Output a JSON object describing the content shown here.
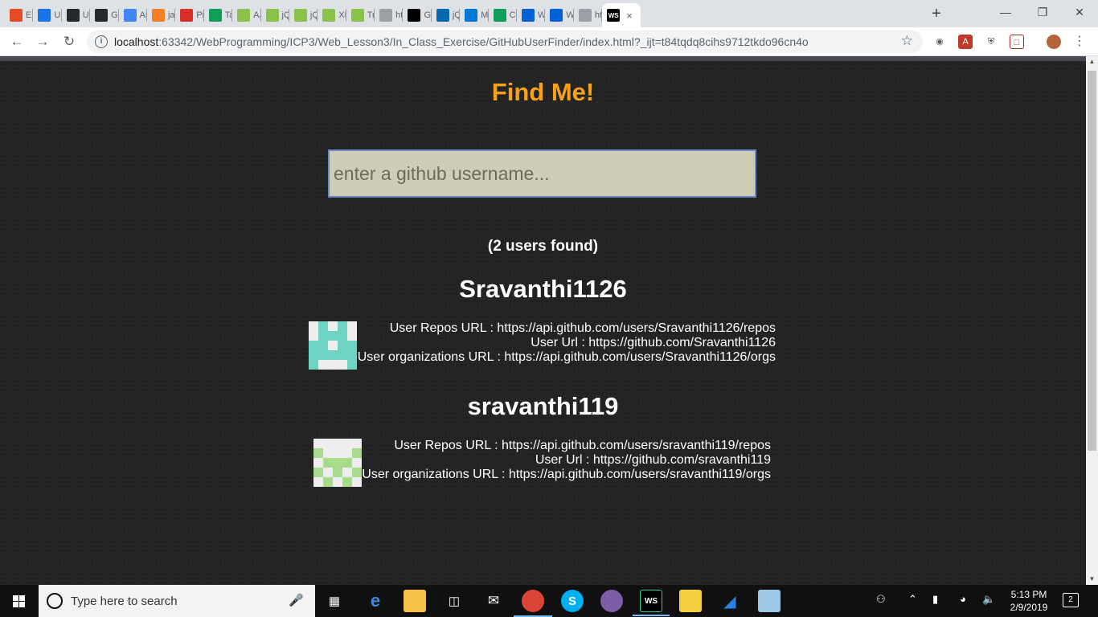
{
  "browser": {
    "tabs": [
      {
        "label": "Ex",
        "icon": "grid-icon",
        "color": "#e34c26"
      },
      {
        "label": "Us",
        "icon": "logo-icon",
        "color": "#1a73e8"
      },
      {
        "label": "Us",
        "icon": "github-icon",
        "color": "#24292e"
      },
      {
        "label": "Gi",
        "icon": "github-icon",
        "color": "#24292e"
      },
      {
        "label": "As",
        "icon": "google-icon",
        "color": "#4285f4"
      },
      {
        "label": "ja",
        "icon": "stackoverflow-icon",
        "color": "#f48024"
      },
      {
        "label": "Pi",
        "icon": "gmail-icon",
        "color": "#d93025"
      },
      {
        "label": "Ta",
        "icon": "drive-icon",
        "color": "#0f9d58"
      },
      {
        "label": "AJ",
        "icon": "w3schools-icon",
        "color": "#8bc34a"
      },
      {
        "label": "jQ",
        "icon": "w3schools-icon",
        "color": "#8bc34a"
      },
      {
        "label": "jQ",
        "icon": "w3schools-icon",
        "color": "#8bc34a"
      },
      {
        "label": "XM",
        "icon": "w3schools-icon",
        "color": "#8bc34a"
      },
      {
        "label": "Tr",
        "icon": "w3schools-icon",
        "color": "#8bc34a"
      },
      {
        "label": "ht",
        "icon": "page-icon",
        "color": "#9aa0a6"
      },
      {
        "label": "Gi",
        "icon": "webstorm-icon",
        "color": "#000000"
      },
      {
        "label": "jQ",
        "icon": "jquery-icon",
        "color": "#0769ad"
      },
      {
        "label": "M",
        "icon": "outlook-icon",
        "color": "#0078d4"
      },
      {
        "label": "CS",
        "icon": "sheets-icon",
        "color": "#0f9d58"
      },
      {
        "label": "W",
        "icon": "box-icon",
        "color": "#0061d5"
      },
      {
        "label": "W",
        "icon": "box-icon",
        "color": "#0061d5"
      },
      {
        "label": "ht",
        "icon": "page-icon",
        "color": "#9aa0a6"
      }
    ],
    "active_tab": {
      "icon": "webstorm-icon",
      "close": "×"
    },
    "new_tab": "+",
    "url_host": "localhost",
    "url_rest": ":63342/WebProgramming/ICP3/Web_Lesson3/In_Class_Exercise/GitHubUserFinder/index.html?_ijt=t84tqdq8cihs9712tkdo96cn4o"
  },
  "page": {
    "title": "Find Me!",
    "search_placeholder": "enter a github username...",
    "results_count": "(2 users found)",
    "users": [
      {
        "login": "Sravanthi1126",
        "repos_line": "User Repos URL : https://api.github.com/users/Sravanthi1126/repos",
        "url_line": "User Url : https://github.com/Sravanthi1126",
        "orgs_line": "User organizations URL : https://api.github.com/users/Sravanthi1126/orgs",
        "avatar_color": "#6fd3c3"
      },
      {
        "login": "sravanthi119",
        "repos_line": "User Repos URL : https://api.github.com/users/sravanthi119/repos",
        "url_line": "User Url : https://github.com/sravanthi119",
        "orgs_line": "User organizations URL : https://api.github.com/users/sravanthi119/orgs",
        "avatar_color": "#a9dc8a"
      }
    ],
    "colors": {
      "title": "#f7a11a",
      "background": "#232323",
      "input_bg": "#cfcdb8"
    }
  },
  "taskbar": {
    "search_text": "Type here to search",
    "time": "5:13 PM",
    "date": "2/9/2019",
    "notifications": "2"
  }
}
